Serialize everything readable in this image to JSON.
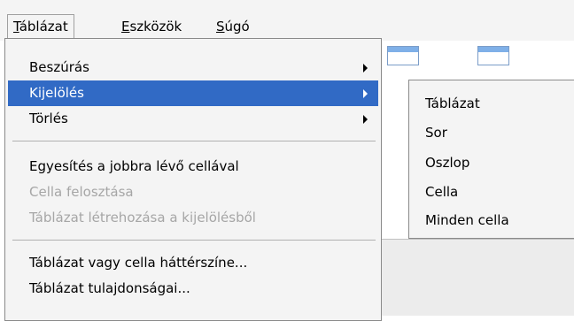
{
  "menubar": {
    "items": [
      {
        "label": "Táblázat",
        "accel": "T",
        "rest": "áblázat"
      },
      {
        "label": "Eszközök",
        "accel": "E",
        "rest": "szközök"
      },
      {
        "label": "Súgó",
        "accel": "S",
        "rest": "úgó"
      }
    ]
  },
  "table_menu": {
    "items": [
      {
        "label": "Beszúrás",
        "has_submenu": true
      },
      {
        "label": "Kijelölés",
        "has_submenu": true,
        "highlighted": true
      },
      {
        "label": "Törlés",
        "has_submenu": true
      },
      {
        "label": "Egyesítés a jobbra lévő cellával",
        "enabled": true
      },
      {
        "label": "Cella felosztása",
        "enabled": false
      },
      {
        "label": "Táblázat létrehozása a kijelölésből",
        "enabled": false
      },
      {
        "label": "Táblázat vagy cella háttérszíne...",
        "enabled": true
      },
      {
        "label": "Táblázat tulajdonságai...",
        "enabled": true
      }
    ]
  },
  "select_submenu": {
    "items": [
      {
        "label": "Táblázat"
      },
      {
        "label": "Sor"
      },
      {
        "label": "Oszlop"
      },
      {
        "label": "Cella"
      },
      {
        "label": "Minden cella"
      }
    ]
  },
  "colors": {
    "highlight": "#316ac5",
    "menu_bg": "#f4f4f4",
    "disabled_text": "#a6a6a6"
  }
}
